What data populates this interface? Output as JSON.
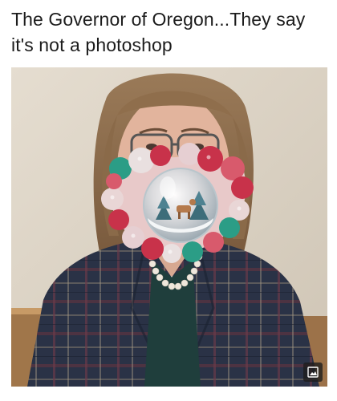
{
  "post": {
    "caption": "The Governor of Oregon...They say it's not a photoshop"
  },
  "image": {
    "alt": "Woman wearing a festive pom-pom mask with a snow globe in the center",
    "badge_icon": "image-icon"
  },
  "colors": {
    "wall": "#d8cfc0",
    "jacket": "#2b3447",
    "accent_red": "#c8324a",
    "accent_teal": "#2b9d86"
  }
}
